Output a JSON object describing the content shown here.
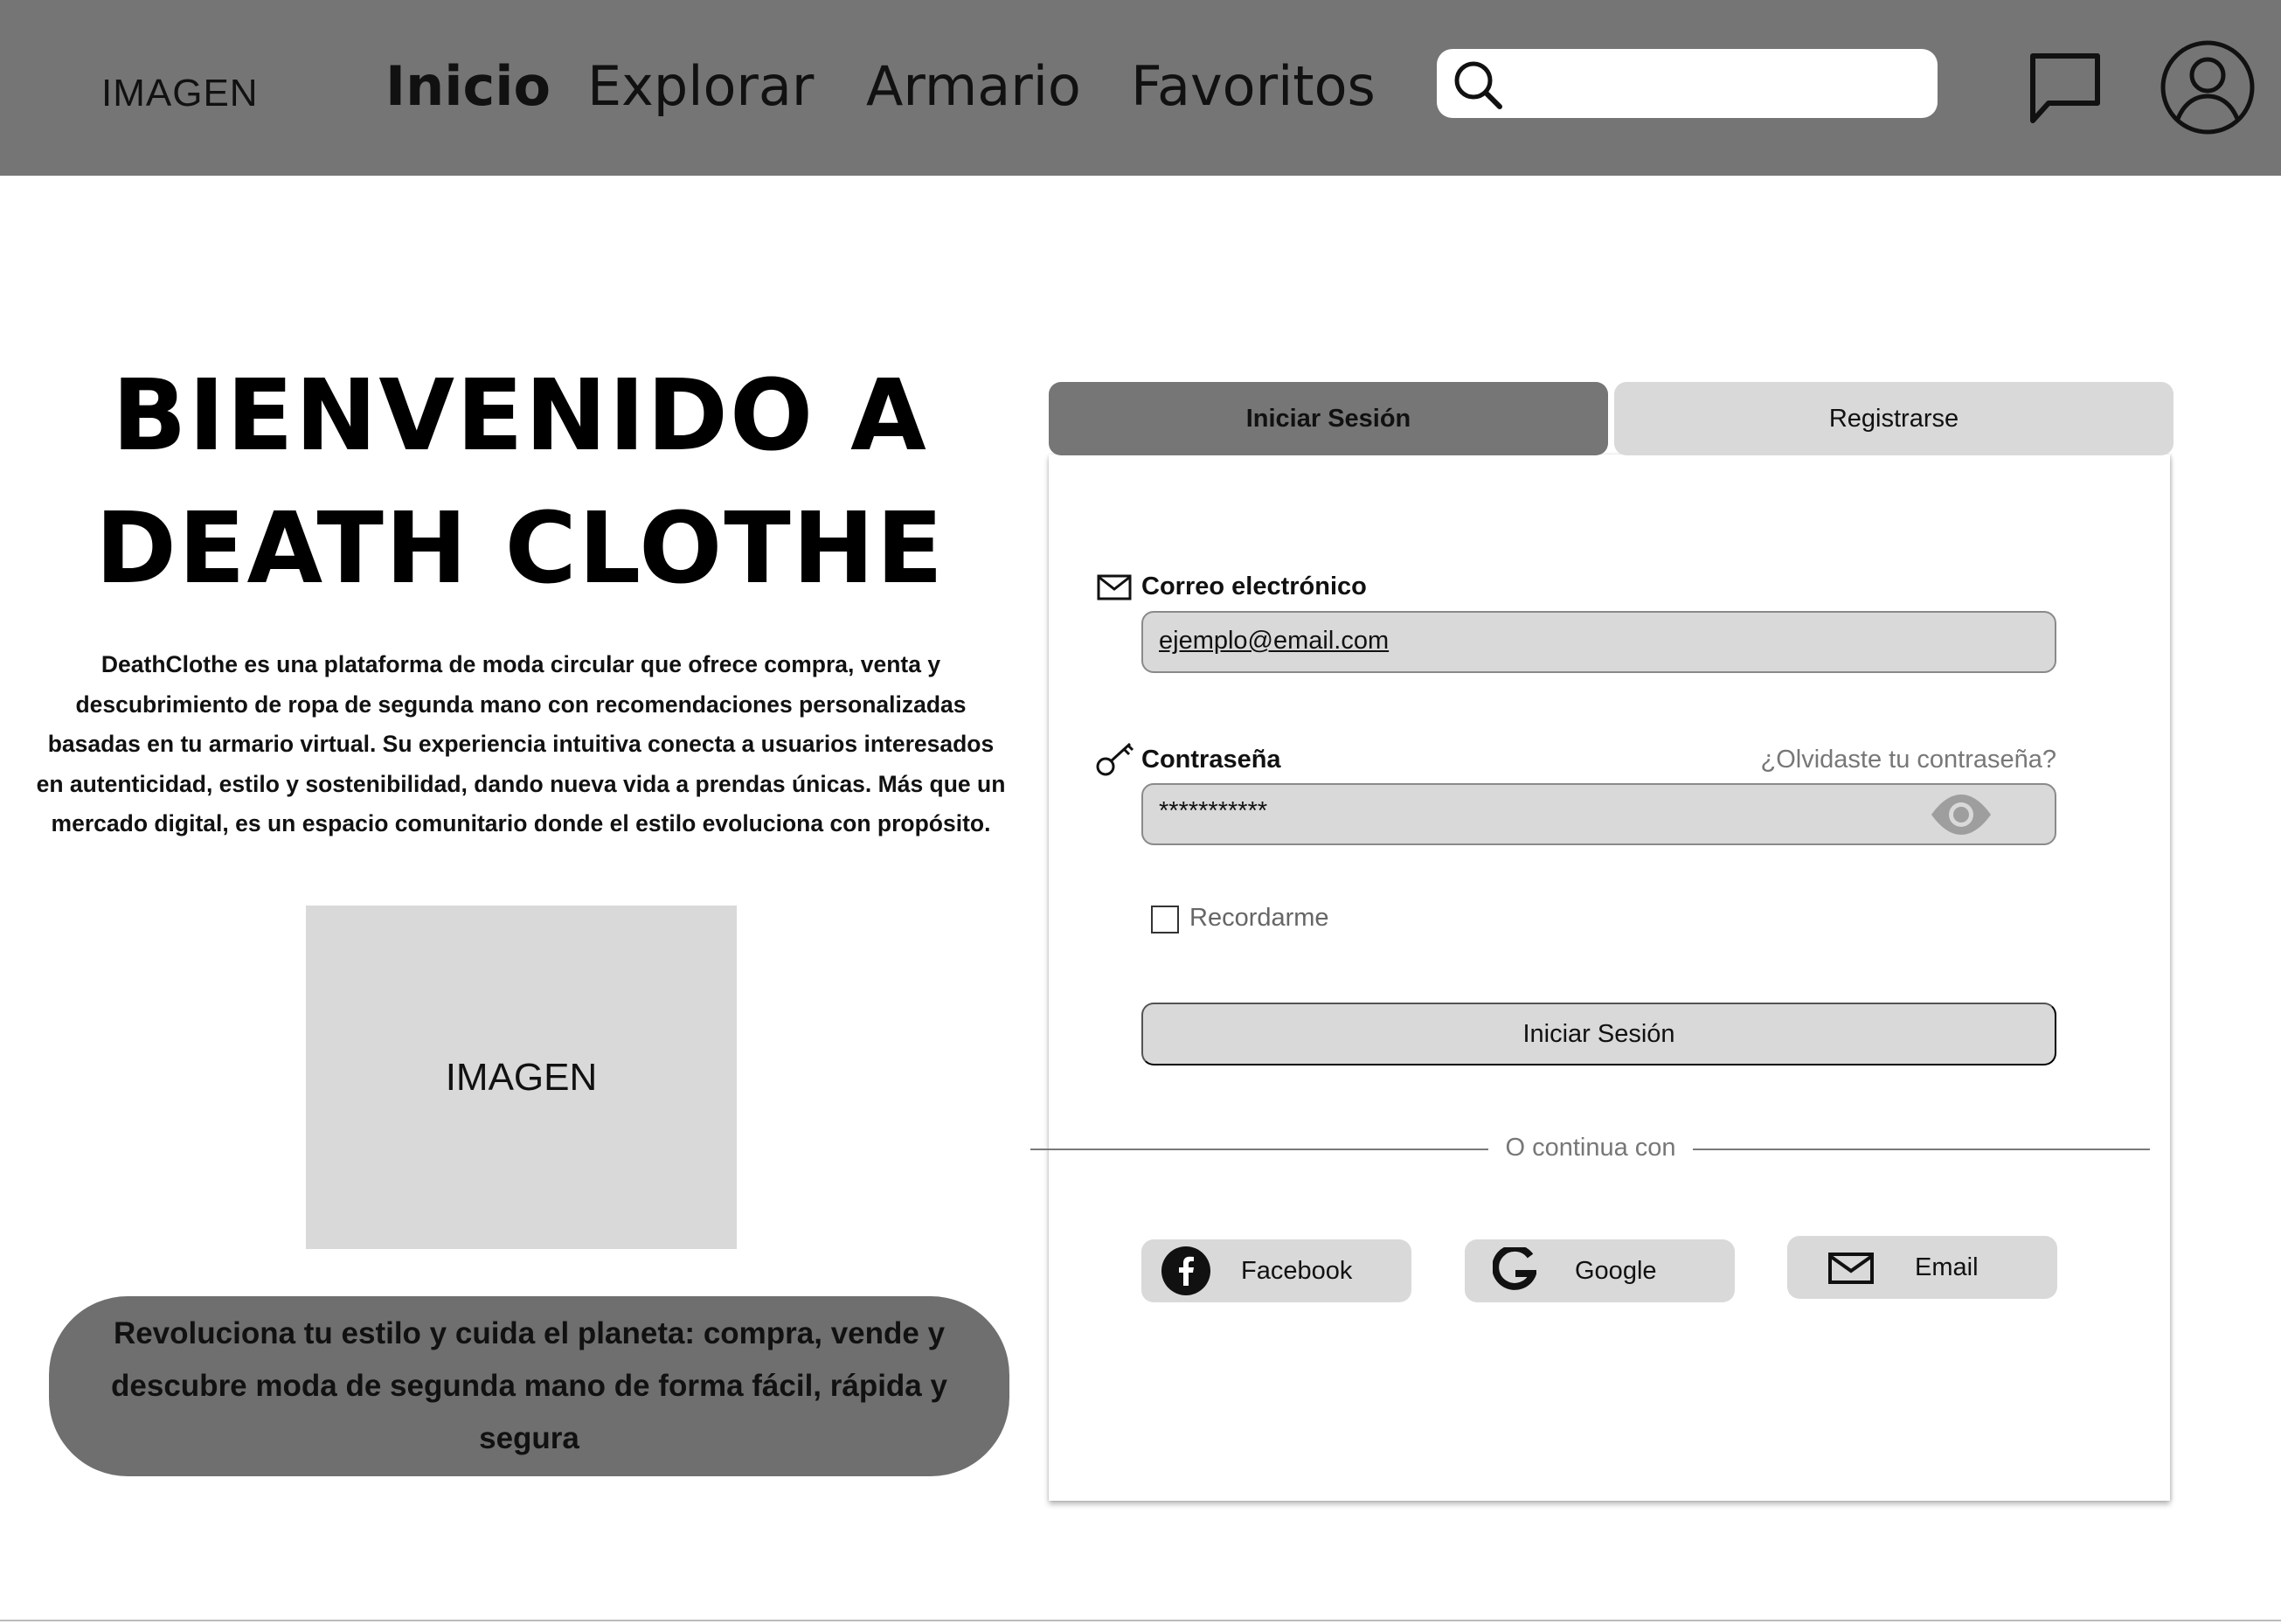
{
  "header": {
    "logo": "IMAGEN",
    "nav": [
      {
        "label": "Inicio",
        "active": true
      },
      {
        "label": "Explorar",
        "active": false
      },
      {
        "label": "Armario",
        "active": false
      },
      {
        "label": "Favoritos",
        "active": false
      }
    ],
    "search": {
      "value": "",
      "icon": "search-icon"
    },
    "icons": [
      "chat-icon",
      "user-avatar-icon"
    ]
  },
  "hero": {
    "title_line1": "BIENVENIDO A",
    "title_line2": "DEATH CLOTHE",
    "description": "DeathClothe es una plataforma de moda circular que ofrece compra, venta y descubrimiento de ropa de segunda mano con recomendaciones personalizadas basadas en tu armario virtual. Su experiencia intuitiva conecta a usuarios interesados en autenticidad, estilo y sostenibilidad, dando nueva vida a prendas únicas. Más que un mercado digital, es un espacio comunitario donde el estilo evoluciona con propósito.",
    "image_placeholder": "IMAGEN",
    "tagline": "Revoluciona tu estilo y cuida el planeta: compra, vende y descubre moda de segunda mano de forma fácil, rápida y segura"
  },
  "auth": {
    "tabs": [
      {
        "label": "Iniciar Sesión",
        "selected": true
      },
      {
        "label": "Registrarse",
        "selected": false
      }
    ],
    "email": {
      "label": "Correo electrónico",
      "value": "ejemplo@email.com",
      "icon": "mail-icon"
    },
    "password": {
      "label": "Contraseña",
      "value": "***********",
      "icon": "key-icon",
      "forgot_link": "¿Olvidaste tu contraseña?",
      "toggle_icon": "eye-icon"
    },
    "remember": {
      "label": "Recordarme",
      "checked": false
    },
    "submit_label": "Iniciar Sesión",
    "divider_text": "O continua con",
    "social": [
      {
        "label": "Facebook",
        "icon": "facebook-icon"
      },
      {
        "label": "Google",
        "icon": "google-icon"
      },
      {
        "label": "Email",
        "icon": "mail-icon"
      }
    ]
  },
  "colors": {
    "header_bg": "#757575",
    "active_tab": "#767676",
    "inactive_tab": "#d9d9d9",
    "pill_bg": "#6f6f6f",
    "input_bg": "#d9d9d9"
  }
}
